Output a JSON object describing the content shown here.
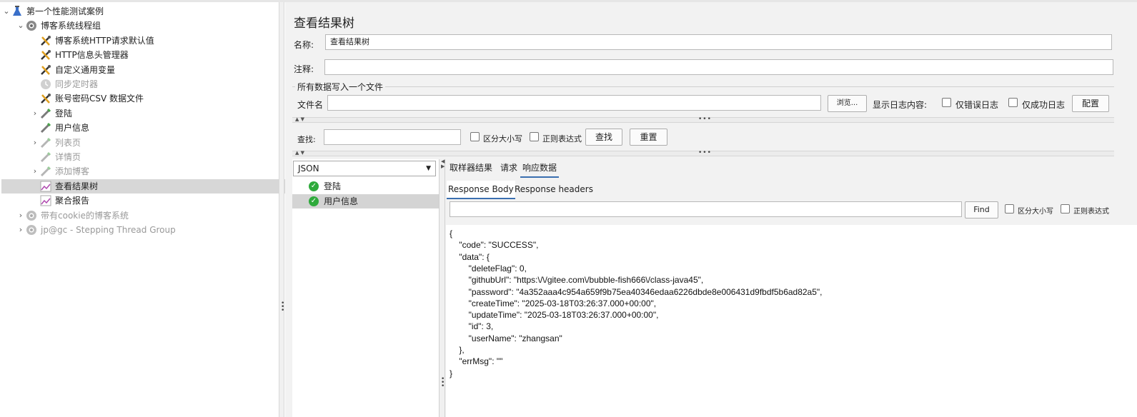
{
  "tree": {
    "items": [
      {
        "label": "第一个性能测试案例",
        "indent": 0,
        "chev": "⌄",
        "icon": "flask-icon",
        "disabled": false,
        "selected": false
      },
      {
        "label": "博客系统线程组",
        "indent": 1,
        "chev": "⌄",
        "icon": "thread-group-gear-icon",
        "disabled": false,
        "selected": false
      },
      {
        "label": "博客系统HTTP请求默认值",
        "indent": 2,
        "chev": "",
        "icon": "config-wrench-icon",
        "disabled": false,
        "selected": false
      },
      {
        "label": "HTTP信息头管理器",
        "indent": 2,
        "chev": "",
        "icon": "config-wrench-icon",
        "disabled": false,
        "selected": false
      },
      {
        "label": "自定义通用变量",
        "indent": 2,
        "chev": "",
        "icon": "config-wrench-icon",
        "disabled": false,
        "selected": false
      },
      {
        "label": "同步定时器",
        "indent": 2,
        "chev": "",
        "icon": "timer-icon",
        "disabled": true,
        "selected": false
      },
      {
        "label": "账号密码CSV 数据文件",
        "indent": 2,
        "chev": "",
        "icon": "config-wrench-icon",
        "disabled": false,
        "selected": false
      },
      {
        "label": "登陆",
        "indent": 2,
        "chev": "›",
        "icon": "sampler-pipette-icon",
        "disabled": false,
        "selected": false
      },
      {
        "label": "用户信息",
        "indent": 2,
        "chev": "",
        "icon": "sampler-pipette-icon",
        "disabled": false,
        "selected": false
      },
      {
        "label": "列表页",
        "indent": 2,
        "chev": "›",
        "icon": "sampler-pipette-icon",
        "disabled": true,
        "selected": false
      },
      {
        "label": "详情页",
        "indent": 2,
        "chev": "",
        "icon": "sampler-pipette-icon",
        "disabled": true,
        "selected": false
      },
      {
        "label": "添加博客",
        "indent": 2,
        "chev": "›",
        "icon": "sampler-pipette-icon",
        "disabled": true,
        "selected": false
      },
      {
        "label": "查看结果树",
        "indent": 2,
        "chev": "",
        "icon": "listener-chart-icon",
        "disabled": false,
        "selected": true
      },
      {
        "label": "聚合报告",
        "indent": 2,
        "chev": "",
        "icon": "listener-chart-icon",
        "disabled": false,
        "selected": false
      },
      {
        "label": "带有cookie的博客系统",
        "indent": 1,
        "chev": "›",
        "icon": "thread-group-gear-icon",
        "disabled": true,
        "selected": false
      },
      {
        "label": "jp@gc - Stepping Thread Group",
        "indent": 1,
        "chev": "›",
        "icon": "thread-group-gear-icon",
        "disabled": true,
        "selected": false
      }
    ]
  },
  "panel": {
    "title": "查看结果树",
    "name_label": "名称:",
    "name_value": "查看结果树",
    "comment_label": "注释:",
    "comment_value": "",
    "fieldset_legend": "所有数据写入一个文件",
    "filename_label": "文件名",
    "filename_value": "",
    "browse_button": "浏览...",
    "log_display_label": "显示日志内容:",
    "errors_only_label": "仅错误日志",
    "success_only_label": "仅成功日志",
    "configure_button": "配置",
    "search_label": "查找:",
    "search_value": "",
    "case_sensitive_label": "区分大小写",
    "regex_label": "正则表达式",
    "find_button": "查找",
    "reset_button": "重置"
  },
  "results": {
    "renderer": "JSON",
    "items": [
      {
        "label": "登陆",
        "status": "success",
        "selected": false
      },
      {
        "label": "用户信息",
        "status": "success",
        "selected": true
      }
    ]
  },
  "response": {
    "tabs": [
      "取样器结果",
      "请求",
      "响应数据"
    ],
    "active_tab": "响应数据",
    "subtabs": [
      "Response Body",
      "Response headers"
    ],
    "active_subtab": "Response Body",
    "find_value": "",
    "find_button": "Find",
    "case_sensitive_label": "区分大小写",
    "regex_label": "正则表达式",
    "body_lines": [
      "{",
      "    \"code\": \"SUCCESS\",",
      "    \"data\": {",
      "        \"deleteFlag\": 0,",
      "        \"githubUrl\": \"https:\\/\\/gitee.com\\/bubble-fish666\\/class-java45\",",
      "        \"password\": \"4a352aaa4c954a659f9b75ea40346edaa6226dbde8e006431d9fbdf5b6ad82a5\",",
      "        \"createTime\": \"2025-03-18T03:26:37.000+00:00\",",
      "        \"updateTime\": \"2025-03-18T03:26:37.000+00:00\",",
      "        \"id\": 3,",
      "        \"userName\": \"zhangsan\"",
      "    },",
      "    \"errMsg\": \"\"",
      "}"
    ]
  }
}
